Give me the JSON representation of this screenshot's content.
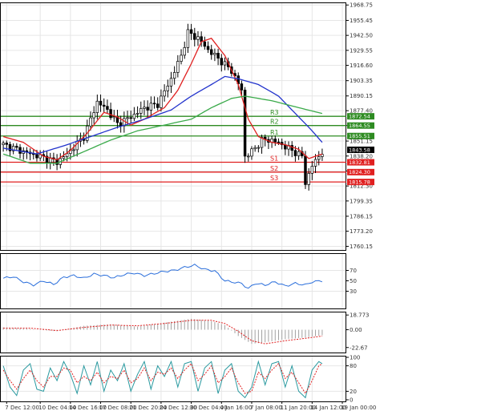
{
  "chart_data": {
    "type": "candlestick",
    "title": "",
    "price_axis": {
      "ticks": [
        1968.75,
        1955.45,
        1942.5,
        1929.55,
        1916.6,
        1903.35,
        1890.15,
        1877.4,
        1864.55,
        1851.15,
        1838.2,
        1825.25,
        1812.3,
        1799.35,
        1786.15,
        1773.2,
        1760.15
      ],
      "range": [
        1757,
        1971
      ]
    },
    "levels": [
      {
        "name": "R3",
        "value": 1872.54,
        "tag": "1872.54",
        "color": "#2e8b22"
      },
      {
        "name": "R2",
        "value": 1864.55,
        "tag": "1864.55",
        "color": "#2e8b22"
      },
      {
        "name": "R1",
        "value": 1855.51,
        "tag": "1855.51",
        "color": "#2e8b22"
      },
      {
        "name": "S1",
        "value": 1832.81,
        "tag": "1832.81",
        "color": "#e02020"
      },
      {
        "name": "S2",
        "value": 1824.3,
        "tag": "1824.30",
        "color": "#e02020"
      },
      {
        "name": "S3",
        "value": 1815.78,
        "tag": "1815.78",
        "color": "#e02020"
      }
    ],
    "last_price": {
      "value": 1843.58,
      "tag": "1843.58"
    },
    "price_keys": [
      [
        0,
        1848
      ],
      [
        6,
        1842
      ],
      [
        13,
        1836
      ],
      [
        16,
        1833
      ],
      [
        19,
        1840
      ],
      [
        24,
        1855
      ],
      [
        28,
        1885
      ],
      [
        31,
        1878
      ],
      [
        34,
        1866
      ],
      [
        38,
        1872
      ],
      [
        42,
        1880
      ],
      [
        46,
        1883
      ],
      [
        50,
        1905
      ],
      [
        53,
        1925
      ],
      [
        55,
        1945
      ],
      [
        58,
        1940
      ],
      [
        61,
        1930
      ],
      [
        65,
        1920
      ],
      [
        68,
        1912
      ],
      [
        71,
        1895
      ],
      [
        72,
        1838
      ],
      [
        74,
        1842
      ],
      [
        77,
        1852
      ],
      [
        80,
        1852
      ],
      [
        83,
        1848
      ],
      [
        86,
        1843
      ],
      [
        89,
        1838
      ],
      [
        90,
        1815
      ],
      [
        92,
        1830
      ],
      [
        95,
        1842
      ]
    ],
    "moving_averages": [
      {
        "name": "",
        "color": "#e02020",
        "keys": [
          [
            0,
            1855
          ],
          [
            6,
            1850
          ],
          [
            12,
            1838
          ],
          [
            16,
            1835
          ],
          [
            20,
            1843
          ],
          [
            25,
            1858
          ],
          [
            30,
            1876
          ],
          [
            34,
            1872
          ],
          [
            38,
            1865
          ],
          [
            42,
            1870
          ],
          [
            48,
            1880
          ],
          [
            52,
            1895
          ],
          [
            56,
            1918
          ],
          [
            59,
            1937
          ],
          [
            62,
            1940
          ],
          [
            66,
            1925
          ],
          [
            70,
            1900
          ],
          [
            73,
            1870
          ],
          [
            76,
            1855
          ],
          [
            80,
            1850
          ],
          [
            84,
            1848
          ],
          [
            88,
            1844
          ],
          [
            91,
            1836
          ],
          [
            95,
            1840
          ]
        ]
      },
      {
        "name": "",
        "color": "#2233cc",
        "keys": [
          [
            0,
            1845
          ],
          [
            10,
            1840
          ],
          [
            18,
            1847
          ],
          [
            26,
            1855
          ],
          [
            34,
            1863
          ],
          [
            42,
            1870
          ],
          [
            50,
            1878
          ],
          [
            56,
            1890
          ],
          [
            62,
            1900
          ],
          [
            66,
            1907
          ],
          [
            70,
            1905
          ],
          [
            76,
            1900
          ],
          [
            82,
            1890
          ],
          [
            88,
            1872
          ],
          [
            92,
            1860
          ],
          [
            95,
            1850
          ]
        ]
      },
      {
        "name": "",
        "color": "#3aaa4a",
        "keys": [
          [
            0,
            1840
          ],
          [
            8,
            1832
          ],
          [
            16,
            1832
          ],
          [
            24,
            1842
          ],
          [
            32,
            1852
          ],
          [
            40,
            1860
          ],
          [
            48,
            1865
          ],
          [
            56,
            1870
          ],
          [
            62,
            1880
          ],
          [
            68,
            1888
          ],
          [
            72,
            1890
          ],
          [
            80,
            1886
          ],
          [
            88,
            1880
          ],
          [
            95,
            1875
          ]
        ]
      }
    ],
    "rsi": {
      "ticks": [
        70,
        50,
        30
      ],
      "range": [
        0,
        100
      ],
      "keys": [
        [
          0,
          55
        ],
        [
          3,
          58
        ],
        [
          6,
          48
        ],
        [
          9,
          42
        ],
        [
          12,
          50
        ],
        [
          15,
          43
        ],
        [
          18,
          57
        ],
        [
          21,
          60
        ],
        [
          24,
          55
        ],
        [
          27,
          63
        ],
        [
          30,
          60
        ],
        [
          33,
          56
        ],
        [
          36,
          62
        ],
        [
          39,
          65
        ],
        [
          42,
          60
        ],
        [
          45,
          64
        ],
        [
          48,
          68
        ],
        [
          51,
          70
        ],
        [
          54,
          76
        ],
        [
          57,
          80
        ],
        [
          60,
          72
        ],
        [
          63,
          69
        ],
        [
          66,
          50
        ],
        [
          68,
          48
        ],
        [
          71,
          45
        ],
        [
          73,
          35
        ],
        [
          75,
          45
        ],
        [
          78,
          42
        ],
        [
          81,
          48
        ],
        [
          84,
          40
        ],
        [
          87,
          45
        ],
        [
          90,
          42
        ],
        [
          92,
          48
        ],
        [
          95,
          50
        ]
      ]
    },
    "macd": {
      "ticks": [
        "18.773",
        "0.00",
        "-22.67"
      ],
      "range": [
        -27,
        21
      ],
      "histogram_keys": [
        [
          0,
          3
        ],
        [
          8,
          1
        ],
        [
          16,
          -2
        ],
        [
          24,
          5
        ],
        [
          32,
          7
        ],
        [
          40,
          4
        ],
        [
          48,
          9
        ],
        [
          56,
          14
        ],
        [
          62,
          11
        ],
        [
          66,
          6
        ],
        [
          70,
          -8
        ],
        [
          74,
          -18
        ],
        [
          78,
          -16
        ],
        [
          84,
          -12
        ],
        [
          90,
          -10
        ],
        [
          95,
          -7
        ]
      ],
      "signal_keys": [
        [
          0,
          2
        ],
        [
          8,
          2
        ],
        [
          16,
          -1
        ],
        [
          24,
          3
        ],
        [
          32,
          6
        ],
        [
          40,
          5
        ],
        [
          48,
          8
        ],
        [
          56,
          12
        ],
        [
          62,
          12
        ],
        [
          66,
          8
        ],
        [
          70,
          -2
        ],
        [
          74,
          -14
        ],
        [
          78,
          -18
        ],
        [
          84,
          -14
        ],
        [
          90,
          -11
        ],
        [
          95,
          -8
        ]
      ]
    },
    "stochastic": {
      "ticks": [
        100,
        80,
        20,
        0
      ],
      "range": [
        0,
        100
      ],
      "k_keys": [
        [
          0,
          80
        ],
        [
          2,
          30
        ],
        [
          4,
          10
        ],
        [
          6,
          70
        ],
        [
          8,
          85
        ],
        [
          10,
          25
        ],
        [
          12,
          20
        ],
        [
          14,
          75
        ],
        [
          16,
          45
        ],
        [
          18,
          90
        ],
        [
          20,
          60
        ],
        [
          22,
          15
        ],
        [
          24,
          80
        ],
        [
          26,
          35
        ],
        [
          28,
          90
        ],
        [
          30,
          20
        ],
        [
          32,
          70
        ],
        [
          34,
          45
        ],
        [
          36,
          85
        ],
        [
          38,
          20
        ],
        [
          40,
          60
        ],
        [
          42,
          90
        ],
        [
          44,
          25
        ],
        [
          46,
          80
        ],
        [
          48,
          55
        ],
        [
          50,
          90
        ],
        [
          52,
          30
        ],
        [
          54,
          85
        ],
        [
          56,
          90
        ],
        [
          58,
          20
        ],
        [
          60,
          75
        ],
        [
          62,
          90
        ],
        [
          64,
          15
        ],
        [
          66,
          70
        ],
        [
          68,
          85
        ],
        [
          70,
          20
        ],
        [
          72,
          5
        ],
        [
          74,
          30
        ],
        [
          76,
          90
        ],
        [
          78,
          35
        ],
        [
          80,
          85
        ],
        [
          82,
          90
        ],
        [
          84,
          30
        ],
        [
          86,
          80
        ],
        [
          88,
          20
        ],
        [
          90,
          5
        ],
        [
          92,
          70
        ],
        [
          94,
          90
        ],
        [
          95,
          85
        ]
      ],
      "d_keys": [
        [
          0,
          70
        ],
        [
          2,
          45
        ],
        [
          4,
          25
        ],
        [
          6,
          50
        ],
        [
          8,
          70
        ],
        [
          10,
          45
        ],
        [
          12,
          30
        ],
        [
          14,
          55
        ],
        [
          16,
          55
        ],
        [
          18,
          75
        ],
        [
          20,
          70
        ],
        [
          22,
          40
        ],
        [
          24,
          55
        ],
        [
          26,
          45
        ],
        [
          28,
          65
        ],
        [
          30,
          40
        ],
        [
          32,
          55
        ],
        [
          34,
          50
        ],
        [
          36,
          70
        ],
        [
          38,
          40
        ],
        [
          40,
          50
        ],
        [
          42,
          75
        ],
        [
          44,
          45
        ],
        [
          46,
          65
        ],
        [
          48,
          60
        ],
        [
          50,
          75
        ],
        [
          52,
          50
        ],
        [
          54,
          70
        ],
        [
          56,
          85
        ],
        [
          58,
          45
        ],
        [
          60,
          60
        ],
        [
          62,
          80
        ],
        [
          64,
          40
        ],
        [
          66,
          55
        ],
        [
          68,
          75
        ],
        [
          70,
          40
        ],
        [
          72,
          15
        ],
        [
          74,
          20
        ],
        [
          76,
          65
        ],
        [
          78,
          50
        ],
        [
          80,
          70
        ],
        [
          82,
          85
        ],
        [
          84,
          50
        ],
        [
          86,
          65
        ],
        [
          88,
          40
        ],
        [
          90,
          15
        ],
        [
          92,
          45
        ],
        [
          94,
          80
        ],
        [
          95,
          85
        ]
      ]
    },
    "x_axis": {
      "labels": [
        {
          "bar": 1,
          "text": "7 Dec 12:00"
        },
        {
          "bar": 11,
          "text": "10 Dec 04:00"
        },
        {
          "bar": 20,
          "text": "14 Dec 16:00"
        },
        {
          "bar": 29,
          "text": "17 Dec 08:00"
        },
        {
          "bar": 38,
          "text": "21 Dec 20:00"
        },
        {
          "bar": 47,
          "text": "24 Dec 12:00"
        },
        {
          "bar": 56,
          "text": "30 Dec 04:00"
        },
        {
          "bar": 65,
          "text": "4 Jan 16:00"
        },
        {
          "bar": 74,
          "text": "7 Jan 08:00"
        },
        {
          "bar": 83,
          "text": "11 Jan 20:00"
        },
        {
          "bar": 92,
          "text": "14 Jan 12:00"
        },
        {
          "bar": 101,
          "text": "19 Jan 00:00"
        }
      ]
    },
    "colors": {
      "bull": "#ffffff",
      "bear": "#000000",
      "outline": "#000000",
      "axis_tag": "#000000",
      "grid": "#e6e6e6",
      "rsi": "#2a6edb",
      "macd_hist": "#a0a0a0",
      "macd_signal": "#e02020",
      "stoch_k": "#2a9aa0",
      "stoch_d": "#e02020"
    }
  }
}
